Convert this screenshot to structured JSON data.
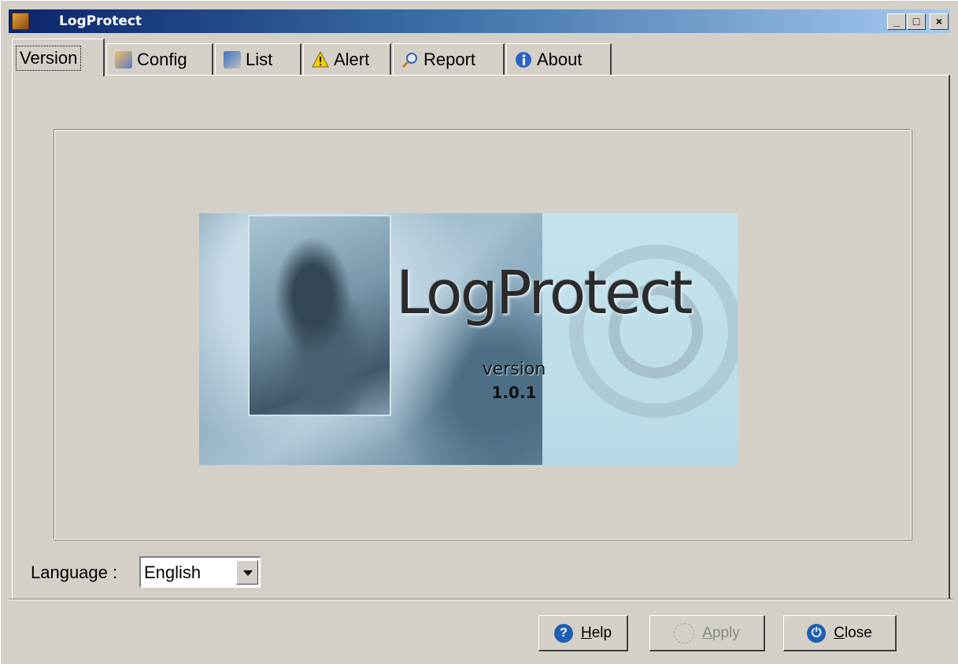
{
  "window": {
    "title": "LogProtect",
    "controls": {
      "minimize": "_",
      "maximize": "□",
      "close": "×"
    }
  },
  "tabs": [
    {
      "label": "Version",
      "icon": "none",
      "active": true
    },
    {
      "label": "Config",
      "icon": "config-icon",
      "active": false
    },
    {
      "label": "List",
      "icon": "list-icon",
      "active": false
    },
    {
      "label": "Alert",
      "icon": "warning-icon",
      "active": false
    },
    {
      "label": "Report",
      "icon": "magnifier-icon",
      "active": false
    },
    {
      "label": "About",
      "icon": "info-icon",
      "active": false
    }
  ],
  "splash": {
    "title": "LogProtect",
    "version_label": "version",
    "version_number": "1.0.1"
  },
  "language": {
    "label": "Language :",
    "selected": "English"
  },
  "buttons": {
    "help": {
      "label": "Help",
      "underline": "H",
      "rest": "elp",
      "enabled": true
    },
    "apply": {
      "label": "Apply",
      "underline": "A",
      "rest": "pply",
      "enabled": false
    },
    "close": {
      "label": "Close",
      "underline": "C",
      "rest": "lose",
      "enabled": true
    }
  },
  "colors": {
    "face": "#d4d0c8",
    "title_gradient_start": "#0a246a",
    "title_gradient_end": "#a6caf0",
    "help_icon": "#1e5fb4",
    "close_icon": "#1e5fb4"
  }
}
